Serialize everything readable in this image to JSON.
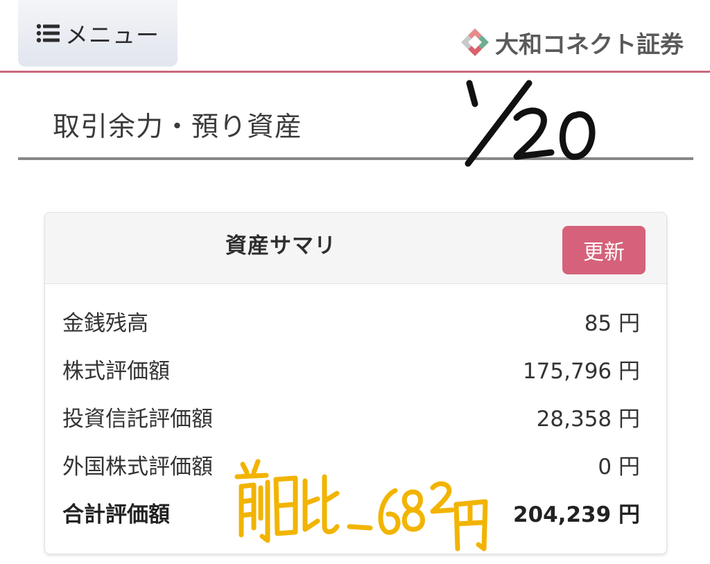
{
  "header": {
    "menu_label": "メニュー",
    "menu_icon": "list-icon",
    "brand_name": "大和コネクト証券",
    "brand_logo_icon": "daiwa-connect-logo",
    "accent_color": "#c9697c"
  },
  "page": {
    "title": "取引余力・預り資産"
  },
  "handwriting": {
    "date": "1/20",
    "note": "前日比 -682円"
  },
  "summary": {
    "title": "資産サマリ",
    "refresh_label": "更新",
    "refresh_color": "#d5627a",
    "rows": [
      {
        "label": "金銭残高",
        "value": "85 円"
      },
      {
        "label": "株式評価額",
        "value": "175,796 円"
      },
      {
        "label": "投資信託評価額",
        "value": "28,358 円"
      },
      {
        "label": "外国株式評価額",
        "value": "0 円"
      },
      {
        "label": "合計評価額",
        "value": "204,239 円"
      }
    ]
  }
}
